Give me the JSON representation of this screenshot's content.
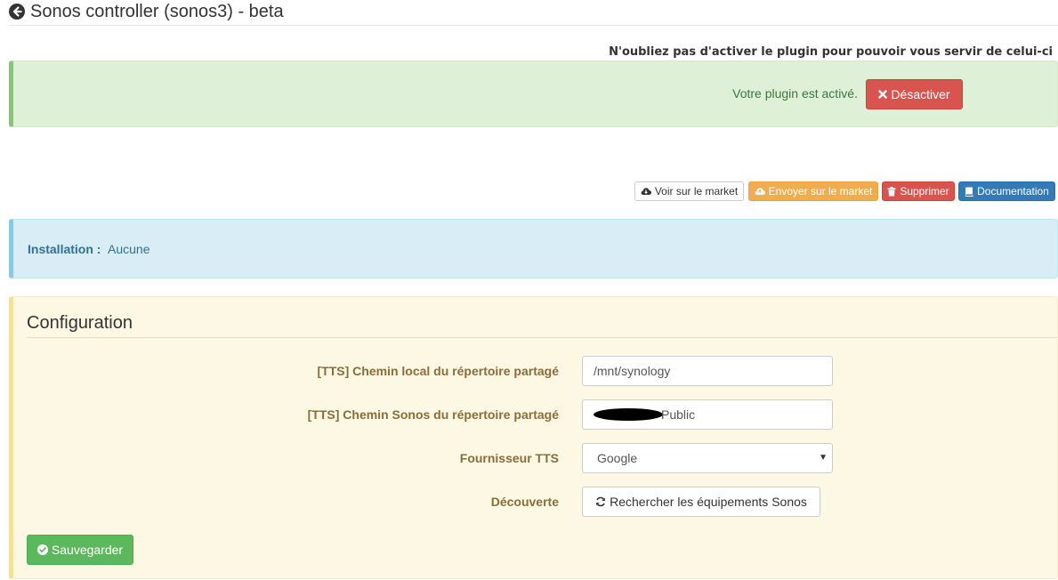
{
  "header": {
    "title": "Sonos controller (sonos3) - beta"
  },
  "activation": {
    "warning": "N'oubliez pas d'activer le plugin pour pouvoir vous servir de celui-ci",
    "status_text": "Votre plugin est activé.",
    "deactivate_label": "Désactiver"
  },
  "actions": {
    "market_view": "Voir sur le market",
    "market_send": "Envoyer sur le market",
    "delete": "Supprimer",
    "documentation": "Documentation"
  },
  "installation": {
    "label": "Installation :",
    "value": "Aucune"
  },
  "configuration": {
    "title": "Configuration",
    "fields": {
      "tts_local_label": "[TTS] Chemin local du répertoire partagé",
      "tts_local_value": "/mnt/synology",
      "tts_sonos_label": "[TTS] Chemin Sonos du répertoire partagé",
      "tts_sonos_value": "Public",
      "tts_provider_label": "Fournisseur TTS",
      "tts_provider_value": "Google",
      "discovery_label": "Découverte",
      "discovery_button": "Rechercher les équipements Sonos"
    },
    "save_label": "Sauvegarder"
  },
  "colors": {
    "success_bg": "#dff0d8",
    "info_bg": "#d9edf7",
    "warning_bg": "#fcf8e3",
    "danger": "#d9534f",
    "warning": "#f0ad4e",
    "primary": "#337ab7",
    "save": "#5cb85c"
  },
  "icons": {
    "back": "arrow-circle-left-icon",
    "deactivate": "times-icon",
    "market_view": "cloud-download-icon",
    "market_send": "cloud-upload-icon",
    "delete": "trash-icon",
    "documentation": "book-icon",
    "discover": "refresh-icon",
    "save": "check-circle-icon"
  }
}
